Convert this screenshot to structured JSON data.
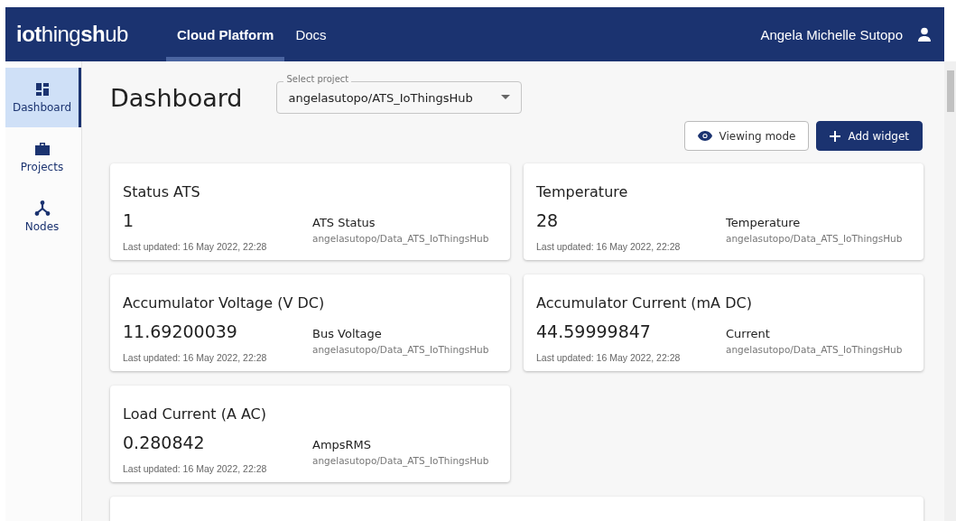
{
  "header": {
    "logo": "**iot**hing**sh**ub",
    "nav": [
      {
        "label": "Cloud Platform",
        "selected": true
      },
      {
        "label": "Docs",
        "selected": false
      }
    ],
    "user": "Angela Michelle Sutopo"
  },
  "sidebar": {
    "items": [
      {
        "label": "Dashboard",
        "kind": "dashboard",
        "selected": true
      },
      {
        "label": "Projects",
        "kind": "projects",
        "selected": false
      },
      {
        "label": "Nodes",
        "kind": "nodes",
        "selected": false
      }
    ]
  },
  "page": {
    "title": "Dashboard",
    "project_select": {
      "label": "Select project",
      "value": "angelasutopo/ATS_IoThingsHub"
    },
    "buttons": [
      {
        "kind": "outline",
        "label": "Viewing mode"
      },
      {
        "kind": "primary",
        "label": "Add widget"
      }
    ]
  },
  "widgets": [
    {
      "title": "Status ATS",
      "value": "1",
      "updated": "Last updated: 16 May 2022, 22:28",
      "variable": "ATS Status",
      "source": "angelasutopo/Data_ATS_IoThingsHub"
    },
    {
      "title": "Temperature",
      "value": "28",
      "updated": "Last updated: 16 May 2022, 22:28",
      "variable": "Temperature",
      "source": "angelasutopo/Data_ATS_IoThingsHub"
    },
    {
      "title": "Accumulator Voltage (V DC)",
      "value": "11.69200039",
      "updated": "Last updated: 16 May 2022, 22:28",
      "variable": "Bus Voltage",
      "source": "angelasutopo/Data_ATS_IoThingsHub"
    },
    {
      "title": "Accumulator Current (mA DC)",
      "value": "44.59999847",
      "updated": "Last updated: 16 May 2022, 22:28",
      "variable": "Current",
      "source": "angelasutopo/Data_ATS_IoThingsHub"
    },
    {
      "title": "Load Current (A AC)",
      "value": "0.280842",
      "updated": "Last updated: 16 May 2022, 22:28",
      "variable": "AmpsRMS",
      "source": "angelasutopo/Data_ATS_IoThingsHub"
    }
  ]
}
